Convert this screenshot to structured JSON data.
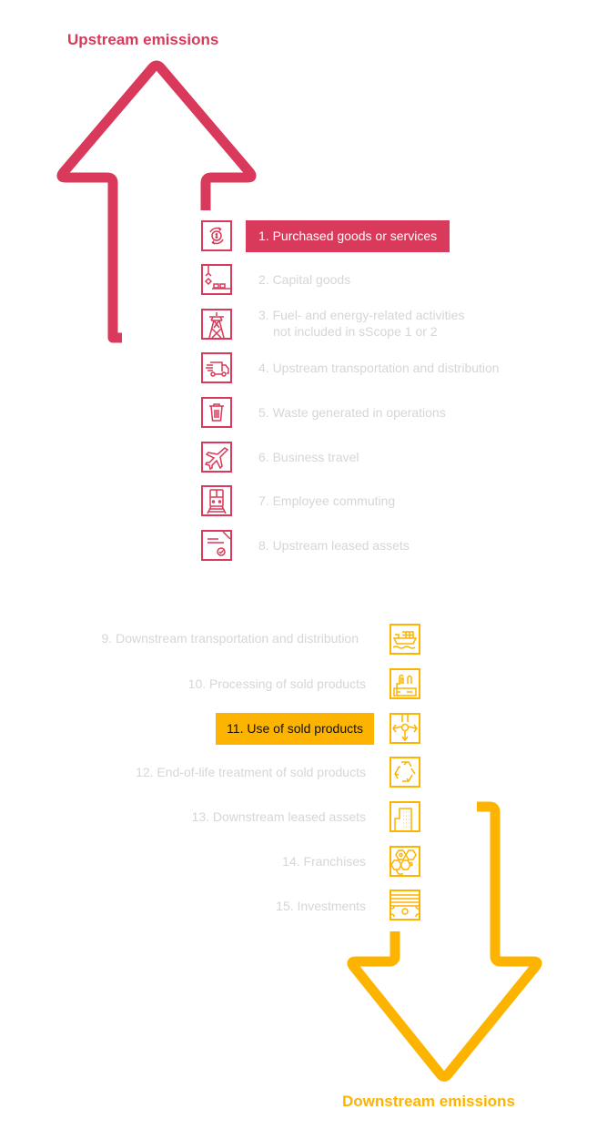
{
  "upstream": {
    "title": "Upstream emissions",
    "color": "#d9395a",
    "items": [
      {
        "label": "1. Purchased goods or services",
        "icon": "money-cycle-icon",
        "highlighted": true
      },
      {
        "label": "2. Capital goods",
        "icon": "crane-icon",
        "highlighted": false
      },
      {
        "label_line1": "3. Fuel- and energy-related activities",
        "label_line2": "not included in sScope 1 or 2",
        "icon": "power-pylon-icon",
        "highlighted": false
      },
      {
        "label": "4. Upstream transportation and distribution",
        "icon": "truck-icon",
        "highlighted": false
      },
      {
        "label": "5. Waste generated in operations",
        "icon": "trash-bin-icon",
        "highlighted": false
      },
      {
        "label": "6. Business travel",
        "icon": "airplane-icon",
        "highlighted": false
      },
      {
        "label": "7. Employee commuting",
        "icon": "train-icon",
        "highlighted": false
      },
      {
        "label": "8. Upstream leased assets",
        "icon": "document-check-icon",
        "highlighted": false
      }
    ]
  },
  "downstream": {
    "title": "Downstream emissions",
    "color": "#fdb400",
    "items": [
      {
        "label": "9. Downstream transportation and distribution",
        "icon": "cargo-ship-icon",
        "highlighted": false
      },
      {
        "label": "10. Processing of sold products",
        "icon": "factory-icon",
        "highlighted": false
      },
      {
        "label": "11. Use of sold products",
        "icon": "distribution-arrows-icon",
        "highlighted": true
      },
      {
        "label": "12. End-of-life treatment of sold products",
        "icon": "recycle-icon",
        "highlighted": false
      },
      {
        "label": "13. Downstream leased assets",
        "icon": "building-icon",
        "highlighted": false
      },
      {
        "label": "14. Franchises",
        "icon": "franchise-hexagons-icon",
        "highlighted": false
      },
      {
        "label": "15. Investments",
        "icon": "banknote-icon",
        "highlighted": false
      }
    ]
  }
}
